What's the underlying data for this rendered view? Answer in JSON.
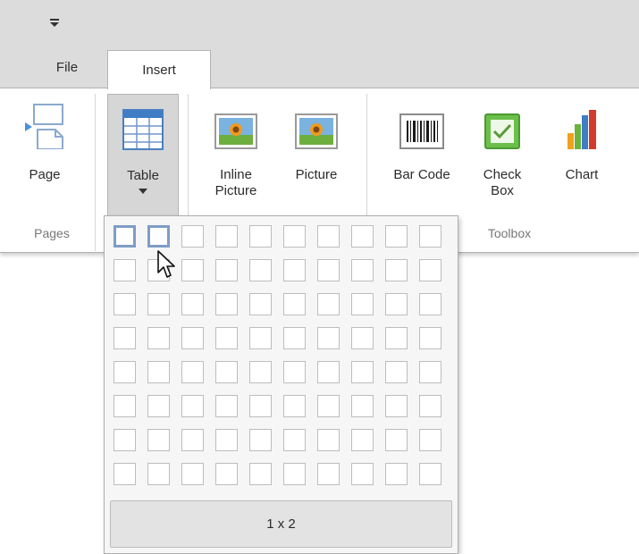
{
  "qat": {
    "dropdown_icon": "qat-dropdown-icon"
  },
  "tabs": [
    {
      "label": "File",
      "active": false
    },
    {
      "label": "Insert",
      "active": true
    }
  ],
  "ribbon": {
    "buttons": [
      {
        "id": "page",
        "label": "Page",
        "icon": "page-icon"
      },
      {
        "id": "table",
        "label": "Table",
        "icon": "table-icon",
        "pressed": true,
        "has_dropdown": true
      },
      {
        "id": "inline-picture",
        "label": "Inline\nPicture",
        "icon": "inline-picture-icon"
      },
      {
        "id": "picture",
        "label": "Picture",
        "icon": "picture-icon"
      },
      {
        "id": "bar-code",
        "label": "Bar Code",
        "icon": "barcode-icon"
      },
      {
        "id": "check-box",
        "label": "Check\nBox",
        "icon": "checkbox-icon"
      },
      {
        "id": "chart",
        "label": "Chart",
        "icon": "chart-icon"
      }
    ],
    "groups": [
      {
        "label": "Pages"
      },
      {
        "label": "Toolbox"
      }
    ]
  },
  "table_popup": {
    "rows": 8,
    "cols": 10,
    "selected_rows": 1,
    "selected_cols": 2,
    "size_label": "1 x 2"
  },
  "colors": {
    "chrome": "#dcdcdc",
    "selection_border": "#7e9dc6",
    "cell_border": "#bdbdbd"
  },
  "cursor": {
    "icon": "mouse-pointer-icon"
  }
}
